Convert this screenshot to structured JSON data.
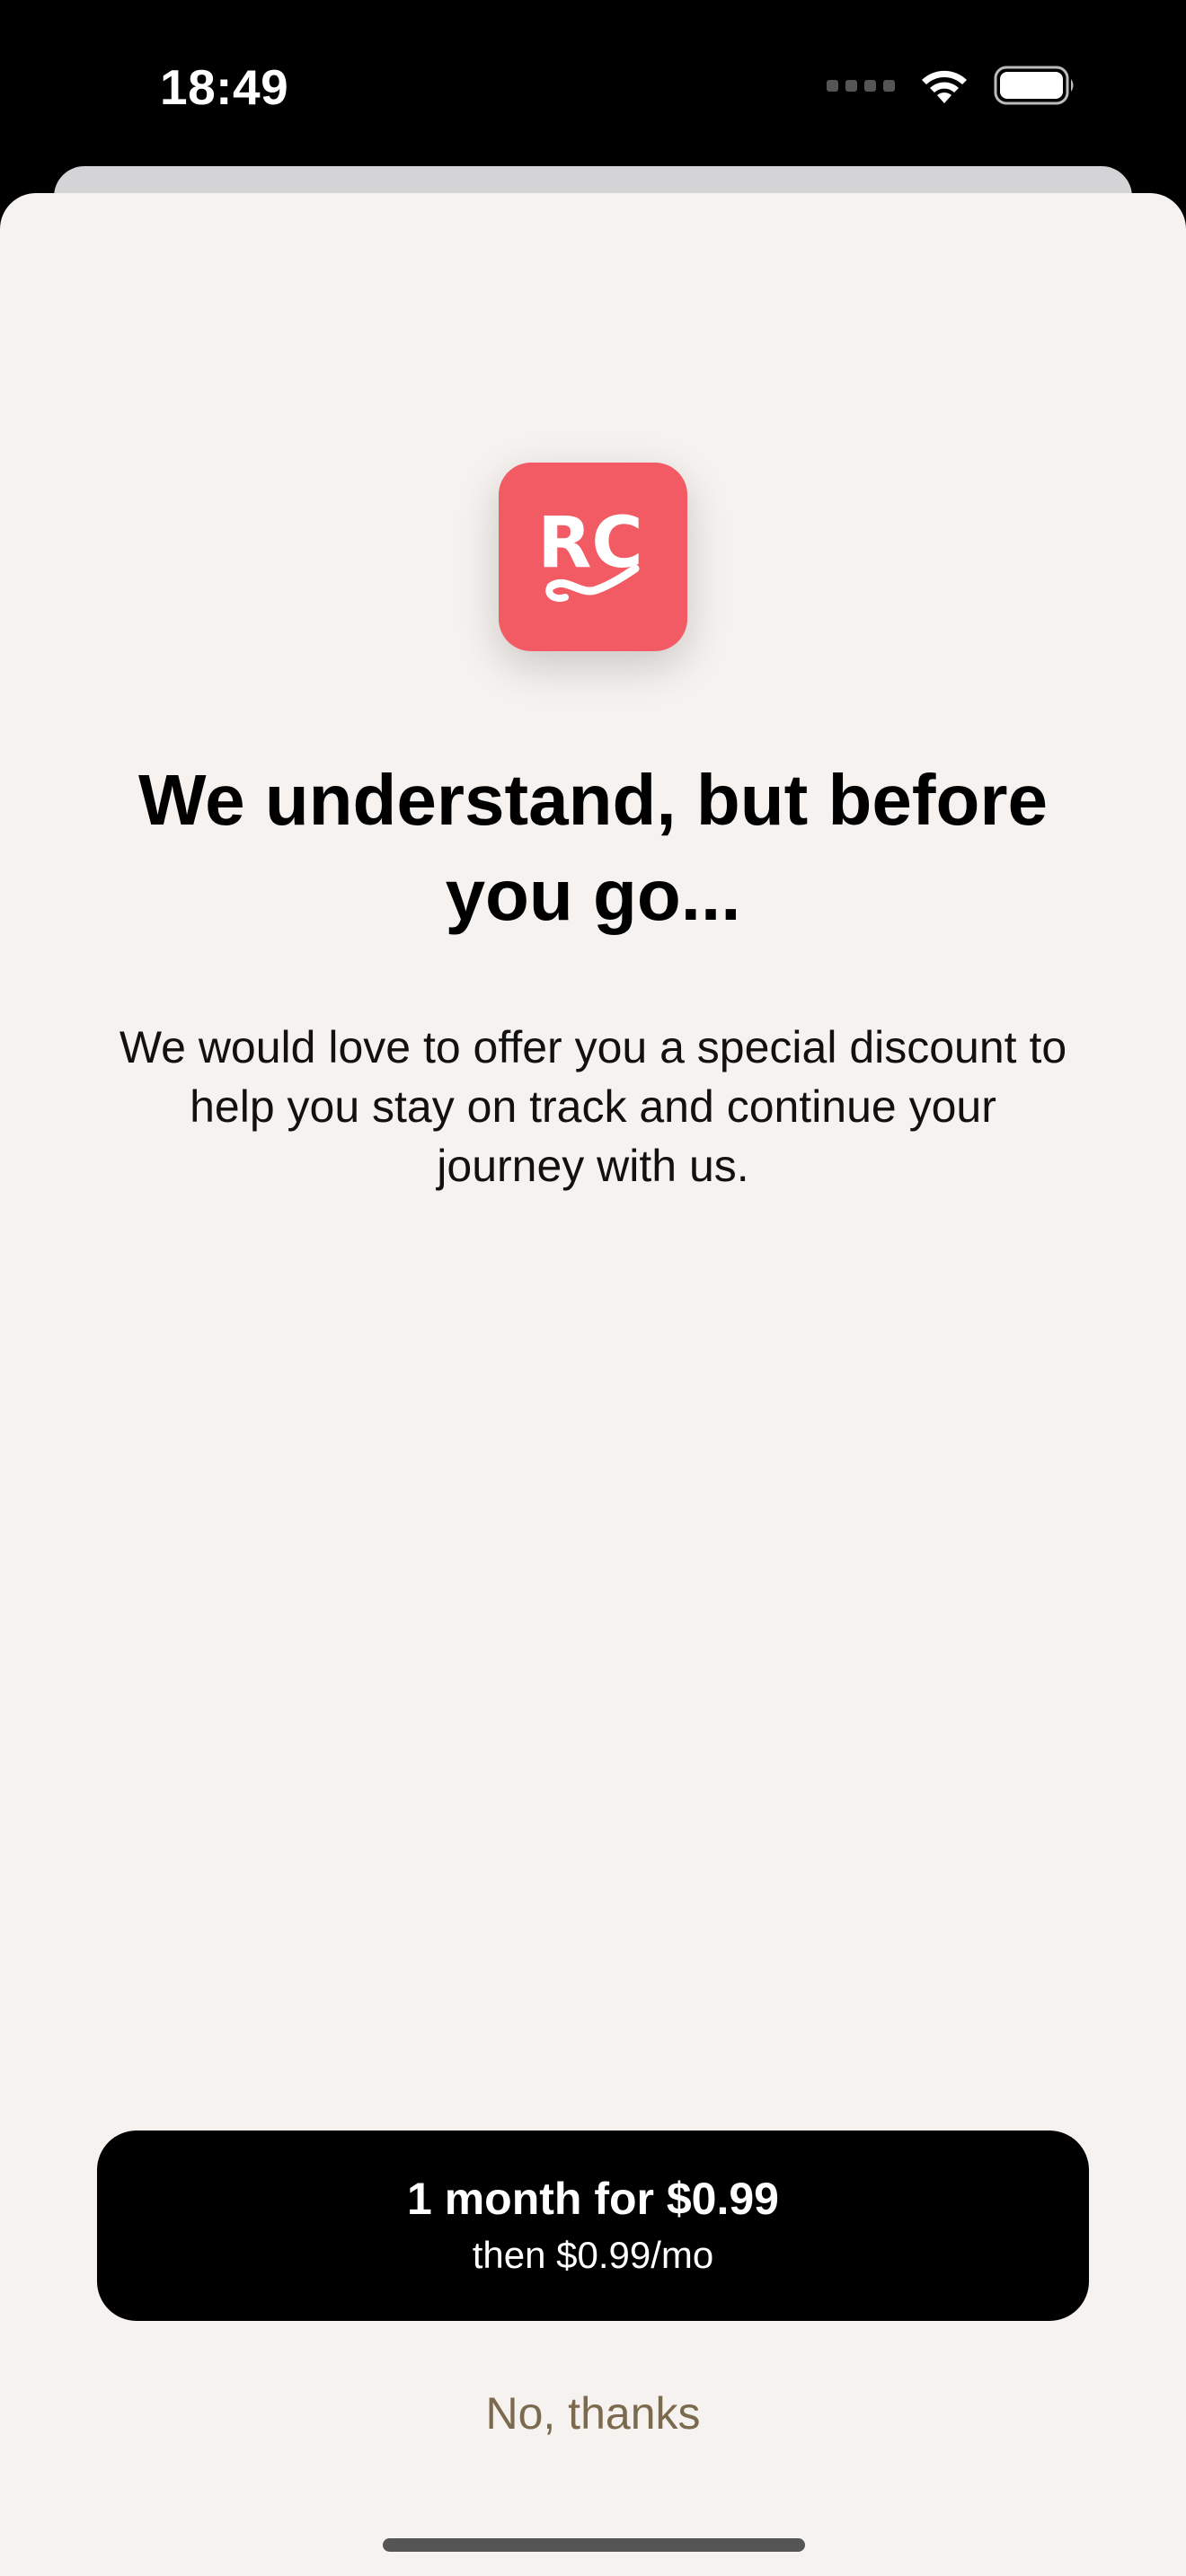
{
  "status_bar": {
    "time": "18:49",
    "icons": [
      "cellular-signal-icon",
      "wifi-icon",
      "battery-icon"
    ]
  },
  "paywall": {
    "logo": {
      "icon": "revenuecat-logo",
      "text": "RC",
      "color": "#f25a64"
    },
    "title": "We understand, but before you go...",
    "subtitle": "We would love to offer you a special discount to help you stay on track and continue your journey with us.",
    "offer_button": {
      "primary_label": "1 month for $0.99",
      "secondary_label": "then $0.99/mo"
    },
    "decline_label": "No, thanks"
  },
  "colors": {
    "sheet_background": "#f6f2ef",
    "button_background": "#000000",
    "decline_text": "#7c6a4e"
  }
}
